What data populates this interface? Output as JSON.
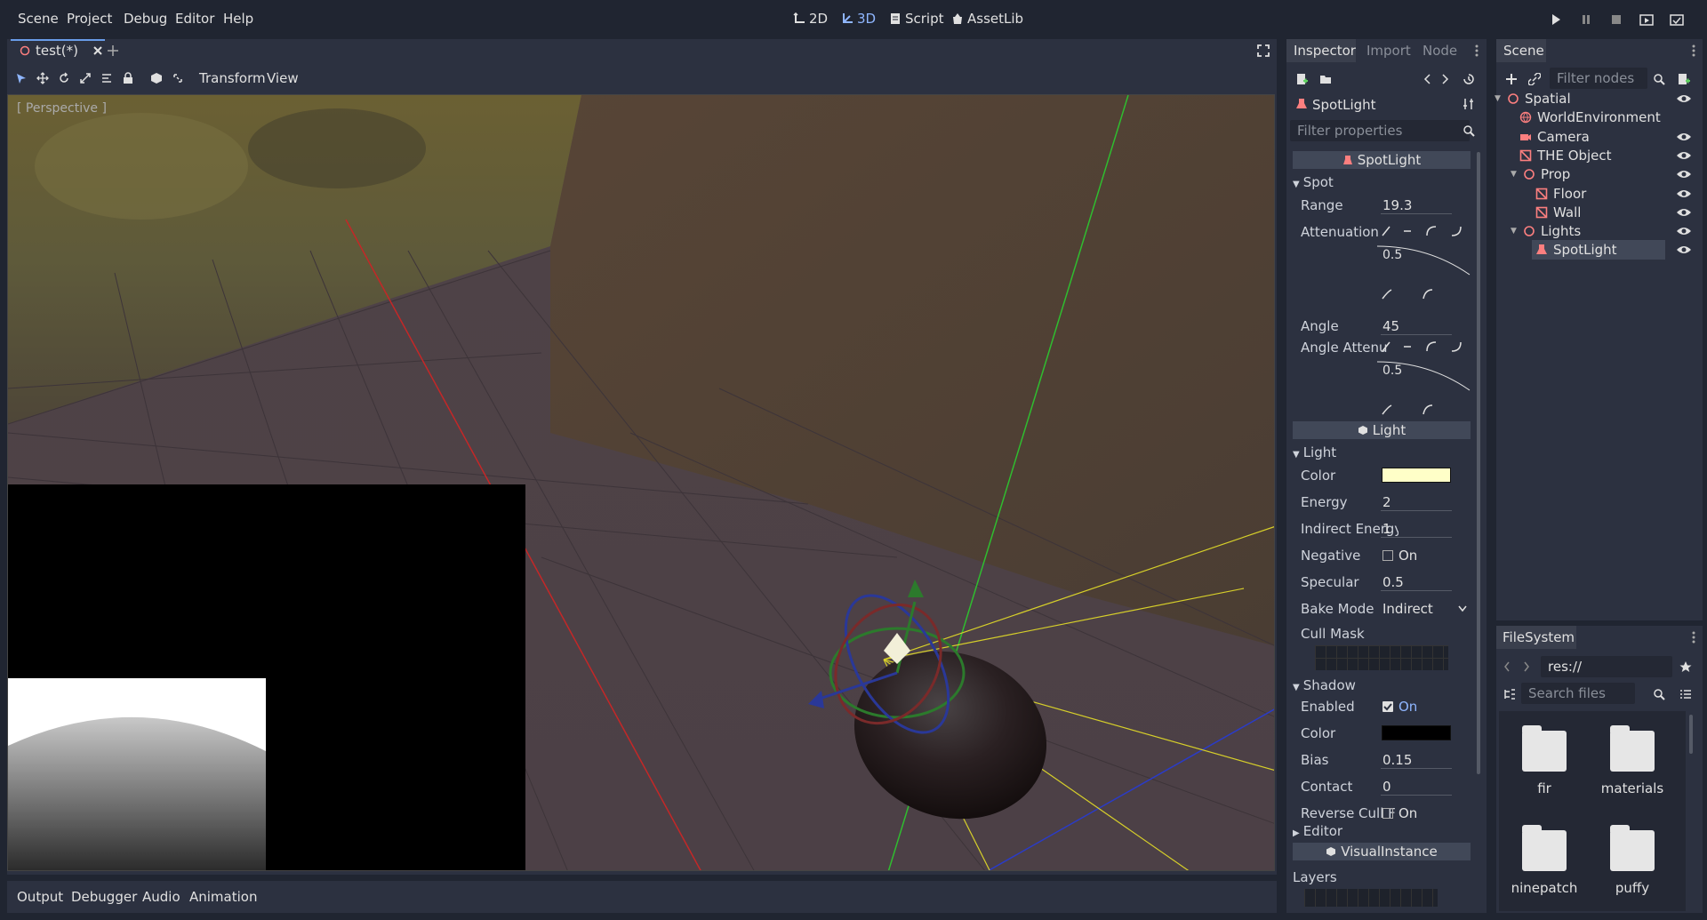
{
  "menubar": {
    "items": [
      "Scene",
      "Project",
      "Debug",
      "Editor",
      "Help"
    ],
    "workspaces": [
      {
        "label": "2D",
        "icon": "2d-icon"
      },
      {
        "label": "3D",
        "icon": "3d-icon",
        "active": true
      },
      {
        "label": "Script",
        "icon": "script-icon"
      },
      {
        "label": "AssetLib",
        "icon": "assetlib-icon"
      }
    ]
  },
  "editor": {
    "tab_label": "test(*)",
    "toolbar_menus": [
      "Transform",
      "View"
    ],
    "viewport_label": "[ Perspective ]"
  },
  "bottom_panel": {
    "items": [
      "Output",
      "Debugger",
      "Audio",
      "Animation"
    ]
  },
  "inspector": {
    "tabs": [
      "Inspector",
      "Import",
      "Node"
    ],
    "object_name": "SpotLight",
    "filter_placeholder": "Filter properties",
    "class_spotlight": "SpotLight",
    "spot_section": "Spot",
    "range_label": "Range",
    "range_value": "19.3",
    "attenuation_label": "Attenuation",
    "attenuation_value": "0.5",
    "angle_label": "Angle",
    "angle_value": "45",
    "angle_atten_label": "Angle Attenu",
    "angle_atten_value": "0.5",
    "class_light": "Light",
    "light_section": "Light",
    "color_label": "Color",
    "light_color": "#ffffc8",
    "energy_label": "Energy",
    "energy_value": "2",
    "indirect_label": "Indirect Energy",
    "indirect_value": "1",
    "negative_label": "Negative",
    "negative_value": "On",
    "specular_label": "Specular",
    "specular_value": "0.5",
    "bake_label": "Bake Mode",
    "bake_value": "Indirect",
    "cull_label": "Cull Mask",
    "shadow_section": "Shadow",
    "enabled_label": "Enabled",
    "enabled_value": "On",
    "shadow_color_label": "Color",
    "shadow_color": "#000000",
    "bias_label": "Bias",
    "bias_value": "0.15",
    "contact_label": "Contact",
    "contact_value": "0",
    "reverse_label": "Reverse Cull F",
    "reverse_value": "On",
    "editor_section": "Editor",
    "class_visual": "VisualInstance",
    "layers_label": "Layers"
  },
  "scene_dock": {
    "title": "Scene",
    "filter_placeholder": "Filter nodes",
    "nodes": [
      {
        "label": "Spatial",
        "icon": "spatial-icon",
        "eye": true
      },
      {
        "label": "WorldEnvironment",
        "icon": "world-environment-icon",
        "eye": false
      },
      {
        "label": "Camera",
        "icon": "camera-icon",
        "eye": true
      },
      {
        "label": "THE Object",
        "icon": "mesh-instance-icon",
        "eye": true
      },
      {
        "label": "Prop",
        "icon": "spatial-icon",
        "eye": true
      },
      {
        "label": "Floor",
        "icon": "mesh-instance-icon",
        "eye": true
      },
      {
        "label": "Wall",
        "icon": "mesh-instance-icon",
        "eye": true
      },
      {
        "label": "Lights",
        "icon": "spatial-icon",
        "eye": true
      },
      {
        "label": "SpotLight",
        "icon": "spotlight-icon",
        "eye": true,
        "selected": true
      }
    ]
  },
  "filesystem": {
    "title": "FileSystem",
    "path": "res://",
    "search_placeholder": "Search files",
    "folders": [
      "fir",
      "materials",
      "ninepatch",
      "puffy"
    ]
  }
}
